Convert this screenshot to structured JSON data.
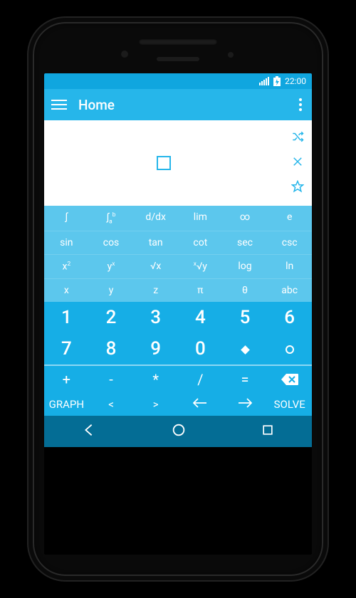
{
  "status": {
    "time": "22:00"
  },
  "appbar": {
    "title": "Home"
  },
  "display": {
    "actions": {
      "shuffle": "shuffle-icon",
      "clear": "close-icon",
      "star": "star-icon"
    }
  },
  "func_rows": [
    [
      "∫",
      "∫ₐᵇ",
      "d/dx",
      "lim",
      "∞",
      "e"
    ],
    [
      "sin",
      "cos",
      "tan",
      "cot",
      "sec",
      "csc"
    ],
    [
      "x²",
      "yˣ",
      "√x",
      "ˣ√y",
      "log",
      "ln"
    ],
    [
      "x",
      "y",
      "z",
      "π",
      "θ",
      "abc"
    ]
  ],
  "num_rows": [
    [
      "1",
      "2",
      "3",
      "4",
      "5",
      "6"
    ],
    [
      "7",
      "8",
      "9",
      "0",
      "◆",
      "○"
    ]
  ],
  "op_row": [
    "+",
    "-",
    "*",
    "/",
    "=",
    "⌫"
  ],
  "ctrl_row": [
    "GRAPH",
    "<",
    ">",
    "⇦",
    "⇨",
    "SOLVE"
  ],
  "nav": {
    "back": "back",
    "home": "home",
    "recent": "recent"
  }
}
